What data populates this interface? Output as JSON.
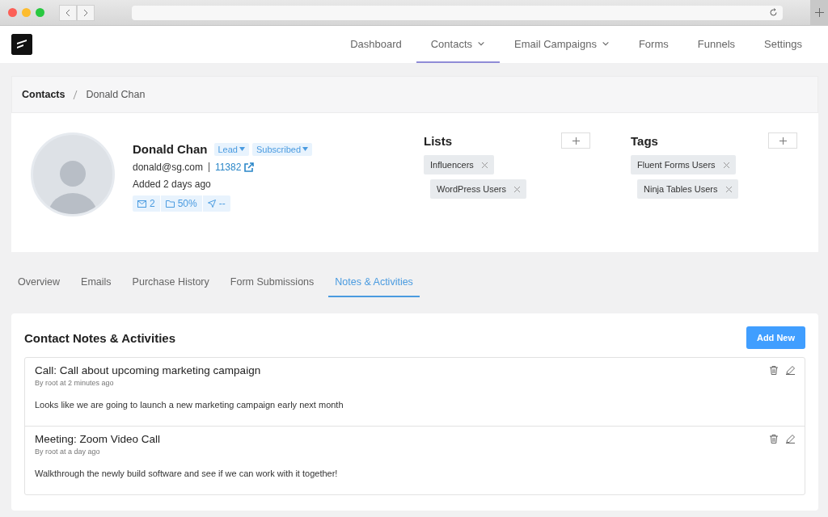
{
  "nav": [
    {
      "label": "Dashboard",
      "selected": false,
      "dropdown": false
    },
    {
      "label": "Contacts",
      "selected": true,
      "dropdown": true
    },
    {
      "label": "Email Campaigns",
      "selected": false,
      "dropdown": true
    },
    {
      "label": "Forms",
      "selected": false,
      "dropdown": false
    },
    {
      "label": "Funnels",
      "selected": false,
      "dropdown": false
    },
    {
      "label": "Settings",
      "selected": false,
      "dropdown": false
    }
  ],
  "breadcrumb": [
    "Contacts",
    "Donald Chan"
  ],
  "contact": {
    "name": "Donald Chan",
    "badges": [
      "Lead",
      "Subscribed"
    ],
    "email": "donald@sg.com",
    "user_id": "11382",
    "added": "Added 2 days ago",
    "stats": [
      {
        "kind": "emails",
        "value": "2"
      },
      {
        "kind": "open_rate",
        "value": "50%"
      },
      {
        "kind": "click_rate",
        "value": "--"
      }
    ]
  },
  "lists": {
    "title": "Lists",
    "items": [
      "Influencers",
      "WordPress Users"
    ]
  },
  "tags": {
    "title": "Tags",
    "items": [
      "Fluent Forms Users",
      "Ninja Tables Users"
    ]
  },
  "tabs": [
    {
      "label": "Overview",
      "selected": false
    },
    {
      "label": "Emails",
      "selected": false
    },
    {
      "label": "Purchase History",
      "selected": false
    },
    {
      "label": "Form Submissions",
      "selected": false
    },
    {
      "label": "Notes & Activities",
      "selected": true
    }
  ],
  "notes": {
    "title": "Contact Notes & Activities",
    "add_button": "Add New",
    "items": [
      {
        "title": "Call: Call about upcoming marketing campaign",
        "meta": "By root at 2 minutes ago",
        "body": "Looks like we are going to launch a new marketing campaign early next month"
      },
      {
        "title": "Meeting: Zoom Video Call",
        "meta": "By root at a day ago",
        "body": "Walkthrough the newly build software and see if we can work with it together!"
      }
    ]
  }
}
